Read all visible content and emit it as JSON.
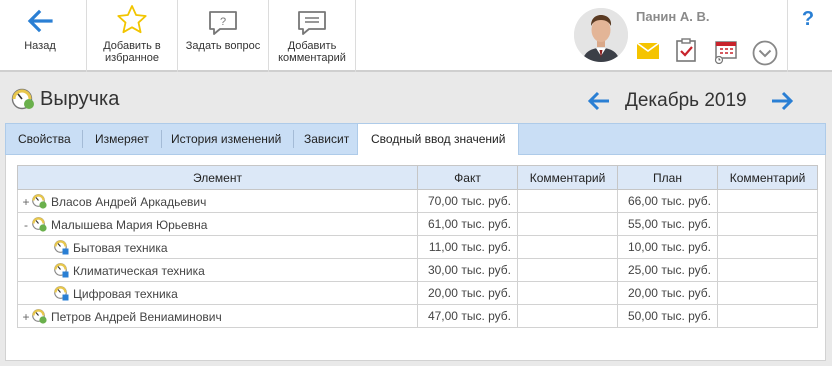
{
  "toolbar": {
    "back_label": "Назад",
    "favorite_label": "Добавить в избранное",
    "ask_label": "Задать вопрос",
    "comment_label": "Добавить комментарий",
    "user_name": "Панин А. В.",
    "help_label": "?"
  },
  "header": {
    "title": "Выручка",
    "period": "Декабрь 2019"
  },
  "tabs": [
    {
      "label": "Свойства",
      "active": false
    },
    {
      "label": "Измеряет",
      "active": false
    },
    {
      "label": "История изменений",
      "active": false
    },
    {
      "label": "Зависит",
      "active": false
    },
    {
      "label": "Сводный ввод значений",
      "active": true
    }
  ],
  "table": {
    "columns": [
      "Элемент",
      "Факт",
      "Комментарий",
      "План",
      "Комментарий"
    ],
    "rows": [
      {
        "toggle": "+",
        "level": 0,
        "name": "Власов Андрей Аркадьевич",
        "fact": "70,00 тыс. руб.",
        "fact_comment": "",
        "plan": "66,00 тыс. руб.",
        "plan_comment": ""
      },
      {
        "toggle": "-",
        "level": 0,
        "name": "Малышева Мария Юрьевна",
        "fact": "61,00 тыс. руб.",
        "fact_comment": "",
        "plan": "55,00 тыс. руб.",
        "plan_comment": ""
      },
      {
        "toggle": "",
        "level": 1,
        "name": "Бытовая техника",
        "fact": "11,00 тыс. руб.",
        "fact_comment": "",
        "plan": "10,00 тыс. руб.",
        "plan_comment": ""
      },
      {
        "toggle": "",
        "level": 1,
        "name": "Климатическая техника",
        "fact": "30,00 тыс. руб.",
        "fact_comment": "",
        "plan": "25,00 тыс. руб.",
        "plan_comment": ""
      },
      {
        "toggle": "",
        "level": 1,
        "name": "Цифровая техника",
        "fact": "20,00 тыс. руб.",
        "fact_comment": "",
        "plan": "20,00 тыс. руб.",
        "plan_comment": ""
      },
      {
        "toggle": "+",
        "level": 0,
        "name": "Петров Андрей Вениаминович",
        "fact": "47,00 тыс. руб.",
        "fact_comment": "",
        "plan": "50,00 тыс. руб.",
        "plan_comment": ""
      }
    ]
  },
  "colors": {
    "accent_blue": "#2a7fd4",
    "star_yellow": "#f2c500",
    "mail_yellow": "#f5c400",
    "tab_bar": "#c9def5",
    "header_cell": "#dce8f7"
  },
  "icons": {
    "back": "arrow-left-icon",
    "favorite": "star-icon",
    "ask": "question-bubble-icon",
    "comment": "comment-bubble-icon",
    "mail": "mail-icon",
    "tasks": "checklist-icon",
    "calendar": "calendar-icon",
    "more": "chevron-down-circle-icon",
    "help": "help-icon"
  }
}
